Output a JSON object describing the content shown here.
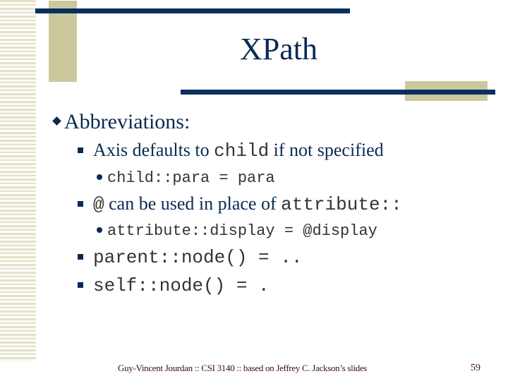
{
  "slide": {
    "title": "XPath",
    "bullets": {
      "b1": {
        "text": "Abbreviations:"
      },
      "b1_1": {
        "pre": "Axis defaults to ",
        "code": "child",
        "post": " if not specified"
      },
      "b1_1_1": {
        "code": "child::para = para"
      },
      "b1_2": {
        "code_pre": "@",
        "text": " can be used in place of ",
        "code": "attribute::"
      },
      "b1_2_1": {
        "code": "attribute::display = @display"
      },
      "b1_3": {
        "code": "parent::node() = .."
      },
      "b1_4": {
        "code": "self::node() = ."
      }
    },
    "footer": "Guy-Vincent Jourdan :: CSI 3140 :: based on Jeffrey C. Jackson’s slides",
    "page_number": "59"
  },
  "colors": {
    "title": "#0a2a52",
    "bar": "#06305e",
    "tan": "#cbc99c",
    "stripe": "#e3e1c8",
    "footer": "#3a1010"
  }
}
